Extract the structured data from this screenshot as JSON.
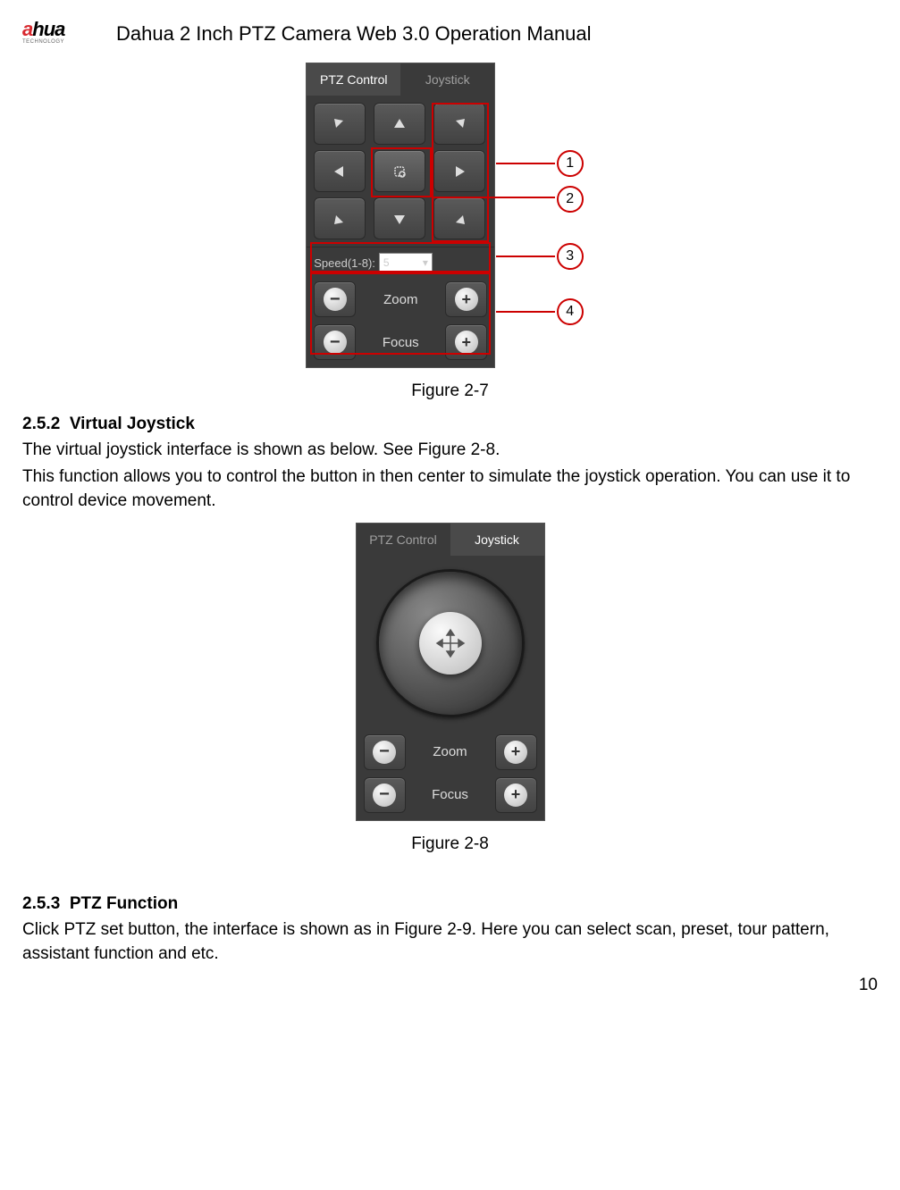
{
  "header": {
    "logo_brand_a": "a",
    "logo_brand_b": "hua",
    "logo_sub": "TECHNOLOGY",
    "title": "Dahua 2 Inch PTZ Camera Web 3.0 Operation Manual"
  },
  "fig27": {
    "tabs": {
      "ptz": "PTZ Control",
      "joy": "Joystick"
    },
    "speed_label": "Speed(1-8):",
    "speed_value": "5",
    "zoom_label": "Zoom",
    "focus_label": "Focus",
    "callouts": {
      "c1": "1",
      "c2": "2",
      "c3": "3",
      "c4": "4"
    },
    "caption": "Figure 2-7"
  },
  "sec252": {
    "num": "2.5.2",
    "title": "Virtual Joystick",
    "p1": "The virtual joystick interface is shown as below. See Figure 2-8.",
    "p2": "This function allows you to control the button in then center to simulate the joystick operation. You can use it to control device movement."
  },
  "fig28": {
    "tabs": {
      "ptz": "PTZ Control",
      "joy": "Joystick"
    },
    "zoom_label": "Zoom",
    "focus_label": "Focus",
    "caption": "Figure 2-8"
  },
  "sec253": {
    "num": "2.5.3",
    "title": "PTZ Function",
    "p1": "Click PTZ set button, the interface is shown as in Figure 2-9. Here you can select scan, preset, tour pattern, assistant function and etc."
  },
  "page_number": "10"
}
